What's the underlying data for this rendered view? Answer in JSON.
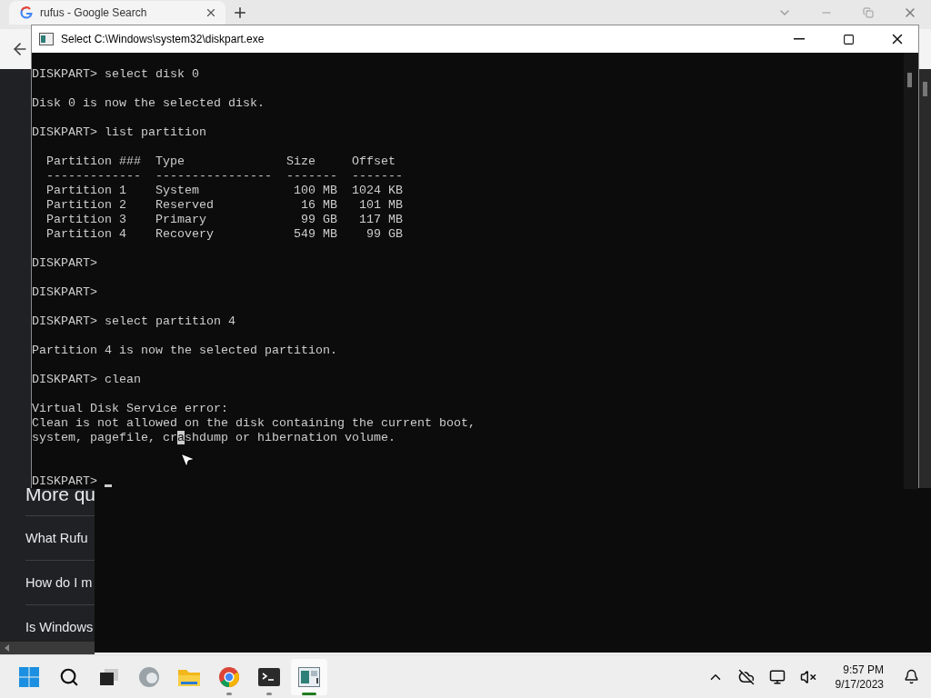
{
  "browser": {
    "tab": {
      "title": "rufus - Google Search",
      "selected": true
    },
    "questions_heading": "More qu",
    "questions": [
      "What Rufu",
      "How do I m",
      "Is Windows"
    ]
  },
  "console": {
    "title": "Select C:\\Windows\\system32\\diskpart.exe",
    "lines": [
      {
        "kind": "text",
        "text": "DISKPART> select disk 0"
      },
      {
        "kind": "blank"
      },
      {
        "kind": "text",
        "text": "Disk 0 is now the selected disk."
      },
      {
        "kind": "blank"
      },
      {
        "kind": "text",
        "text": "DISKPART> list partition"
      },
      {
        "kind": "blank"
      },
      {
        "kind": "text",
        "text": "  Partition ###  Type              Size     Offset"
      },
      {
        "kind": "text",
        "text": "  -------------  ----------------  -------  -------"
      },
      {
        "kind": "text",
        "text": "  Partition 1    System             100 MB  1024 KB"
      },
      {
        "kind": "text",
        "text": "  Partition 2    Reserved            16 MB   101 MB"
      },
      {
        "kind": "text",
        "text": "  Partition 3    Primary             99 GB   117 MB"
      },
      {
        "kind": "text",
        "text": "  Partition 4    Recovery           549 MB    99 GB"
      },
      {
        "kind": "blank"
      },
      {
        "kind": "text",
        "text": "DISKPART>"
      },
      {
        "kind": "blank"
      },
      {
        "kind": "text",
        "text": "DISKPART>"
      },
      {
        "kind": "blank"
      },
      {
        "kind": "text",
        "text": "DISKPART> select partition 4"
      },
      {
        "kind": "blank"
      },
      {
        "kind": "text",
        "text": "Partition 4 is now the selected partition."
      },
      {
        "kind": "blank"
      },
      {
        "kind": "text",
        "text": "DISKPART> clean"
      },
      {
        "kind": "blank"
      },
      {
        "kind": "text",
        "text": "Virtual Disk Service error:"
      },
      {
        "kind": "text",
        "text": "Clean is not allowed on the disk containing the current boot,"
      },
      {
        "kind": "segments",
        "segments": [
          {
            "text": "system, pagefile, cr",
            "selected": false
          },
          {
            "text": "a",
            "selected": true
          },
          {
            "text": "shdump or hibernation volume.",
            "selected": false
          }
        ]
      },
      {
        "kind": "blank"
      },
      {
        "kind": "blank"
      },
      {
        "kind": "text",
        "text": "DISKPART>",
        "cursor": true
      }
    ]
  },
  "taskbar": {
    "apps": [
      {
        "kind": "start",
        "running": false,
        "selected": false
      },
      {
        "kind": "search",
        "running": false,
        "selected": false
      },
      {
        "kind": "taskview",
        "running": false,
        "selected": false
      },
      {
        "kind": "edge",
        "running": false,
        "selected": false
      },
      {
        "kind": "explorer",
        "running": false,
        "selected": false
      },
      {
        "kind": "chrome",
        "running": true,
        "selected": false
      },
      {
        "kind": "terminal",
        "running": true,
        "selected": false
      },
      {
        "kind": "diskpart",
        "running": true,
        "selected": true
      }
    ],
    "time": "9:57 PM",
    "date": "9/17/2023"
  }
}
